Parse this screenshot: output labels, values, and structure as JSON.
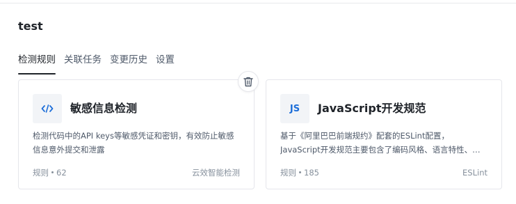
{
  "page": {
    "title": "test"
  },
  "tabs": [
    {
      "label": "检测规则",
      "active": true
    },
    {
      "label": "关联任务",
      "active": false
    },
    {
      "label": "变更历史",
      "active": false
    },
    {
      "label": "设置",
      "active": false
    }
  ],
  "cards": [
    {
      "icon": "code-icon",
      "name": "敏感信息检测",
      "description": "检测代码中的API keys等敏感凭证和密钥，有效防止敏感信息意外提交和泄露",
      "rule_label": "规则",
      "rule_count": "62",
      "source": "云效智能检测"
    },
    {
      "icon": "javascript-icon",
      "icon_text": "JS",
      "name": "JavaScript开发规范",
      "description": "基于《阿里巴巴前端规约》配套的ESLint配置，JavaScript开发规范主要包含了编码风格、语言特性、…",
      "rule_label": "规则",
      "rule_count": "185",
      "source": "ESLint"
    }
  ],
  "icons": {
    "delete": "trash-icon"
  },
  "colors": {
    "accent": "#1e6fd9",
    "text_primary": "#1f2329",
    "text_secondary": "#4e5969",
    "text_muted": "#86909c",
    "border": "#e5e6eb"
  }
}
